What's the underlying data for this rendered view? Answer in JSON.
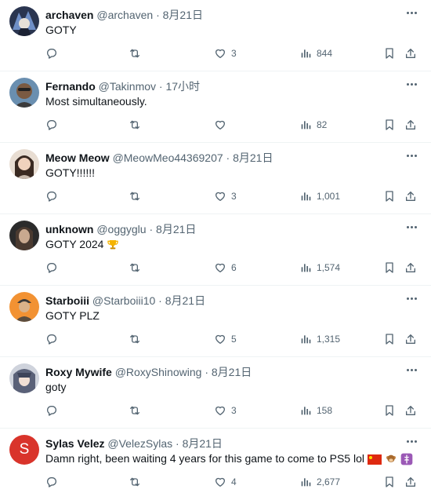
{
  "tweets": [
    {
      "name": "archaven",
      "handle": "@archaven",
      "sep": "·",
      "time": "8月21日",
      "text": "GOTY",
      "reply_count": "",
      "retweet_count": "",
      "like_count": "3",
      "views": "844",
      "avatar": "archaven-avatar"
    },
    {
      "name": "Fernando",
      "handle": "@Takinmov",
      "sep": "·",
      "time": "17小时",
      "text": "Most simultaneously.",
      "reply_count": "",
      "retweet_count": "",
      "like_count": "",
      "views": "82",
      "avatar": "fernando-avatar"
    },
    {
      "name": "Meow Meow",
      "handle": "@MeowMeo44369207",
      "sep": "·",
      "time": "8月21日",
      "text": "GOTY!!!!!!",
      "reply_count": "",
      "retweet_count": "",
      "like_count": "3",
      "views": "1,001",
      "avatar": "meow-avatar"
    },
    {
      "name": "unknown",
      "handle": "@oggyglu",
      "sep": "·",
      "time": "8月21日",
      "text": "GOTY 2024",
      "reply_count": "",
      "retweet_count": "",
      "like_count": "6",
      "views": "1,574",
      "avatar": "unknown-avatar"
    },
    {
      "name": "Starboiii",
      "handle": "@Starboiii10",
      "sep": "·",
      "time": "8月21日",
      "text": "GOTY PLZ",
      "reply_count": "",
      "retweet_count": "",
      "like_count": "5",
      "views": "1,315",
      "avatar": "starboiii-avatar"
    },
    {
      "name": "Roxy Mywife",
      "handle": "@RoxyShinowing",
      "sep": "·",
      "time": "8月21日",
      "text": "goty",
      "reply_count": "",
      "retweet_count": "",
      "like_count": "3",
      "views": "158",
      "avatar": "roxy-avatar"
    },
    {
      "name": "Sylas Velez",
      "handle": "@VelezSylas",
      "sep": "·",
      "time": "8月21日",
      "text": "Damn right, been waiting 4 years for this game to come to PS5 lol",
      "reply_count": "",
      "retweet_count": "",
      "like_count": "4",
      "views": "2,677",
      "avatar": "sylas-avatar",
      "avatar_letter": "S"
    }
  ],
  "colors": {
    "text": "#0f1419",
    "muted": "#536471",
    "divider": "#eff3f4",
    "sylas_avatar": "#d9342b"
  }
}
